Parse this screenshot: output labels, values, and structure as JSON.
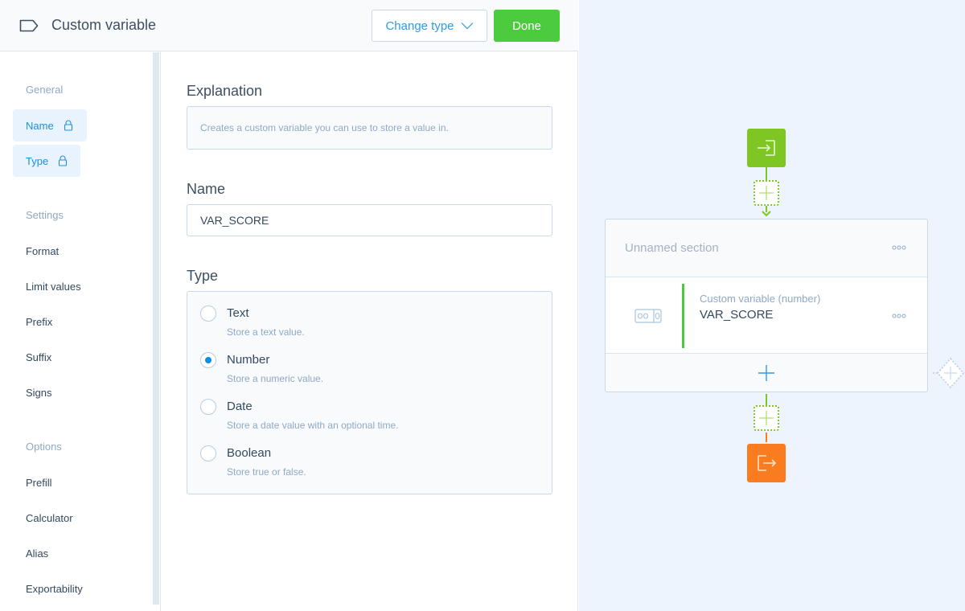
{
  "header": {
    "icon": "tag-icon",
    "title": "Custom variable",
    "change_type_label": "Change type",
    "done_label": "Done"
  },
  "sidebar": {
    "groups": [
      {
        "label": "General",
        "items": [
          {
            "label": "Name",
            "locked": true,
            "active": true
          },
          {
            "label": "Type",
            "locked": true,
            "active": true
          }
        ]
      },
      {
        "label": "Settings",
        "items": [
          {
            "label": "Format"
          },
          {
            "label": "Limit values"
          },
          {
            "label": "Prefix"
          },
          {
            "label": "Suffix"
          },
          {
            "label": "Signs"
          }
        ]
      },
      {
        "label": "Options",
        "items": [
          {
            "label": "Prefill"
          },
          {
            "label": "Calculator"
          },
          {
            "label": "Alias"
          },
          {
            "label": "Exportability"
          }
        ]
      }
    ]
  },
  "form": {
    "explanation_label": "Explanation",
    "explanation_text": "Creates a custom variable you can use to store a value in.",
    "name_label": "Name",
    "name_value": "VAR_SCORE",
    "type_label": "Type",
    "type_options": [
      {
        "label": "Text",
        "description": "Store a text value.",
        "checked": false
      },
      {
        "label": "Number",
        "description": "Store a numeric value.",
        "checked": true
      },
      {
        "label": "Date",
        "description": "Store a date value with an optional time.",
        "checked": false
      },
      {
        "label": "Boolean",
        "description": "Store true or false.",
        "checked": false
      }
    ]
  },
  "canvas": {
    "section_title": "Unnamed section",
    "block_type": "Custom variable (number)",
    "block_name": "VAR_SCORE",
    "colors": {
      "start": "#7ec623",
      "end": "#f97d1f",
      "accent": "#4ccb3f",
      "link": "#2f9be0"
    }
  }
}
